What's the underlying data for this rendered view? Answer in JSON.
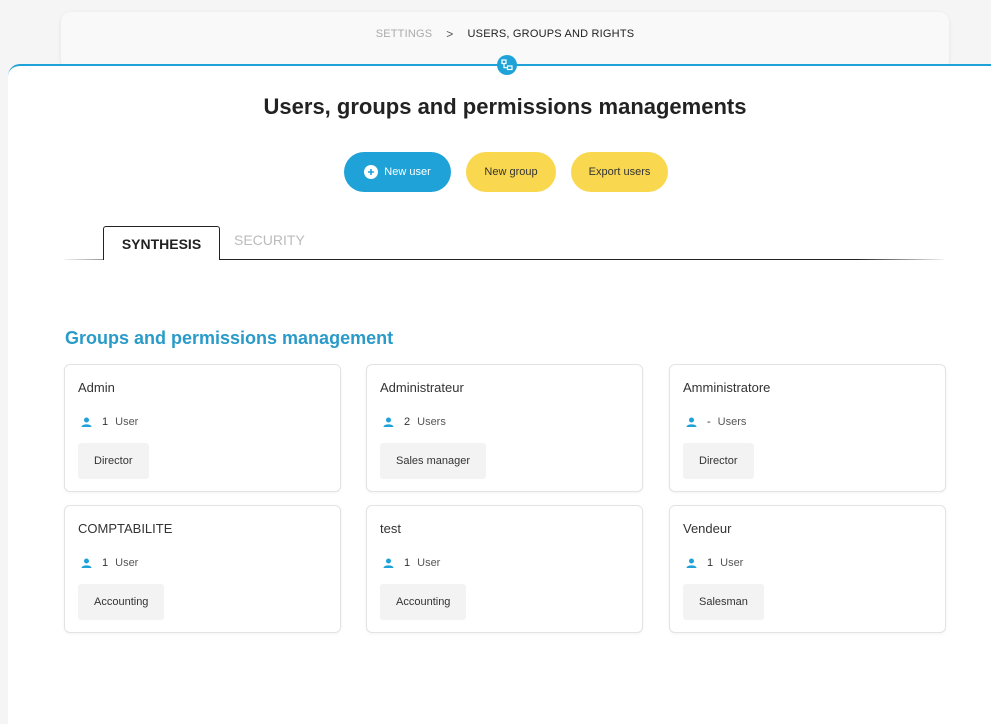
{
  "breadcrumb": {
    "parent": "SETTINGS",
    "separator": ">",
    "current": "USERS, GROUPS AND RIGHTS"
  },
  "page": {
    "title": "Users, groups and permissions managements"
  },
  "actions": {
    "new_user": "New user",
    "new_group": "New group",
    "export_users": "Export users"
  },
  "tabs": [
    {
      "label": "SYNTHESIS",
      "active": true
    },
    {
      "label": "SECURITY",
      "active": false
    }
  ],
  "section": {
    "title": "Groups and permissions management"
  },
  "groups": [
    {
      "name": "Admin",
      "count": "1",
      "unit": "User",
      "tag": "Director"
    },
    {
      "name": "Administrateur",
      "count": "2",
      "unit": "Users",
      "tag": "Sales manager"
    },
    {
      "name": "Amministratore",
      "count": "-",
      "unit": "Users",
      "tag": "Director"
    },
    {
      "name": "COMPTABILITE",
      "count": "1",
      "unit": "User",
      "tag": "Accounting"
    },
    {
      "name": "test",
      "count": "1",
      "unit": "User",
      "tag": "Accounting"
    },
    {
      "name": "Vendeur",
      "count": "1",
      "unit": "User",
      "tag": "Salesman"
    }
  ],
  "colors": {
    "accent": "#1ea2d8",
    "yellow": "#f9d74f",
    "section_title": "#2a9bc9"
  },
  "icons": {
    "user": "user-icon",
    "plus": "plus-circle-icon",
    "badge": "org-chart-icon"
  }
}
